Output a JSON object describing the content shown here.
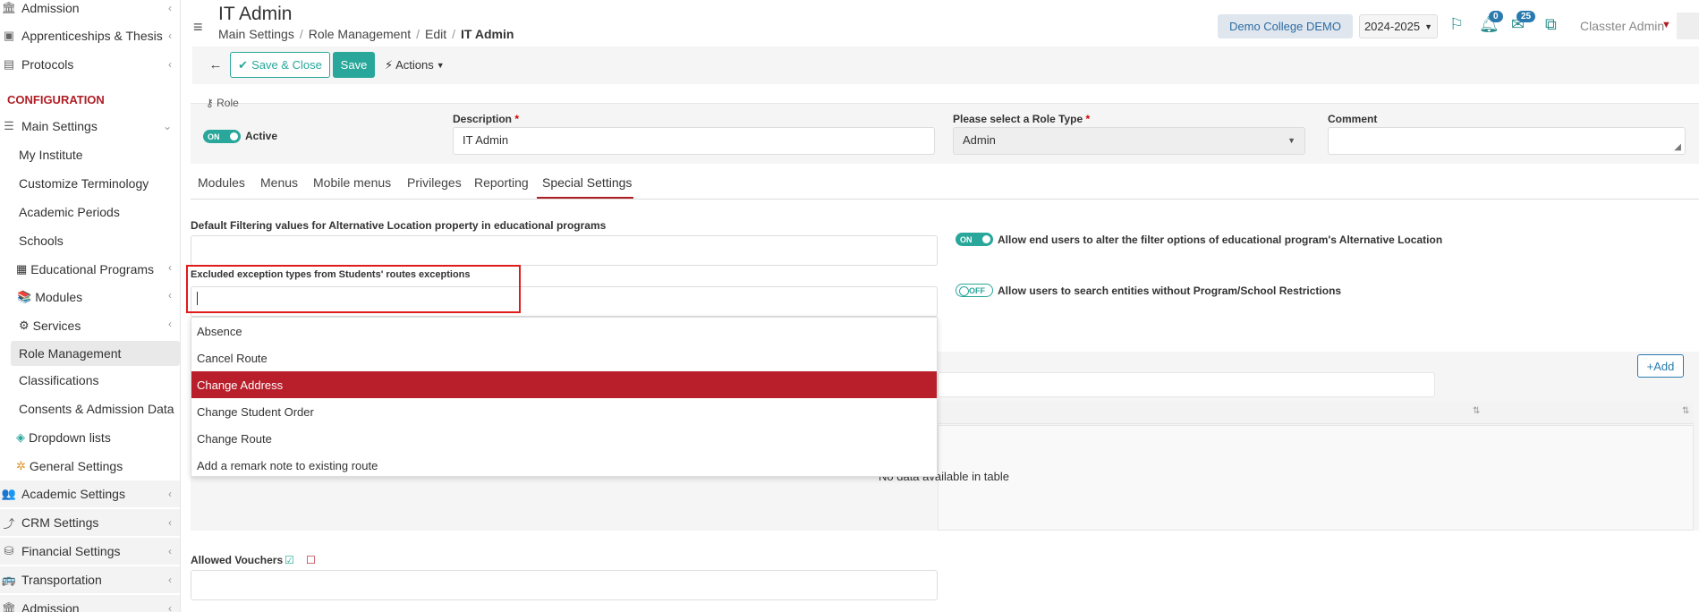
{
  "sidebar": {
    "items_top": [
      {
        "label": "Admission",
        "icon": "bank-icon"
      },
      {
        "label": "Apprenticeships & Thesis",
        "icon": "box-icon"
      },
      {
        "label": "Protocols",
        "icon": "protocol-icon"
      }
    ],
    "config_heading": "CONFIGURATION",
    "main_settings": "Main Settings",
    "sub_items": [
      "My Institute",
      "Customize Terminology",
      "Academic Periods",
      "Schools",
      "Educational Programs",
      "Modules",
      "Services",
      "Role Management",
      "Classifications",
      "Consents & Admission Data",
      "Dropdown lists",
      "General Settings"
    ],
    "items_bottom": [
      {
        "label": "Academic Settings",
        "icon": "people-icon"
      },
      {
        "label": "CRM Settings",
        "icon": "crm-icon"
      },
      {
        "label": "Financial Settings",
        "icon": "coins-icon"
      },
      {
        "label": "Transportation",
        "icon": "bus-icon"
      },
      {
        "label": "Admission",
        "icon": "bank-icon"
      }
    ]
  },
  "header": {
    "title": "IT Admin",
    "breadcrumb": [
      "Main Settings",
      "Role Management",
      "Edit",
      "IT Admin"
    ],
    "college": "Demo College DEMO",
    "year": "2024-2025",
    "notifications_count": "0",
    "messages_count": "25",
    "user": "Classter Admin"
  },
  "toolbar": {
    "save_close": "Save & Close",
    "save": "Save",
    "actions": "Actions"
  },
  "role": {
    "legend": "Role",
    "active_toggle": "ON",
    "active_label": "Active",
    "description_label": "Description",
    "description_value": "IT Admin",
    "role_type_label": "Please select a Role Type",
    "role_type_value": "Admin",
    "comment_label": "Comment"
  },
  "tabs": [
    "Modules",
    "Menus",
    "Mobile menus",
    "Privileges",
    "Reporting",
    "Special Settings"
  ],
  "special": {
    "alt_location_label": "Default Filtering values for Alternative Location property in educational programs",
    "alt_location_toggle": "ON",
    "alt_location_text": "Allow end users to alter the filter options of educational program's Alternative Location",
    "excluded_label": "Excluded exception types from Students' routes exceptions",
    "search_toggle": "OFF",
    "search_text": "Allow users to search entities without Program/School Restrictions",
    "dropdown_options": [
      "Absence",
      "Cancel Route",
      "Change Address",
      "Change Student Order",
      "Change Route",
      "Add a remark note to existing route"
    ],
    "selected_option": "Change Address",
    "add_button": "Add",
    "empty_table": "No data available in table",
    "vouchers_label": "Allowed Vouchers"
  },
  "colors": {
    "accent": "#28a79a",
    "brand_red": "#b01e25",
    "highlight": "#b81f2b",
    "link_blue": "#2a7ab0"
  }
}
